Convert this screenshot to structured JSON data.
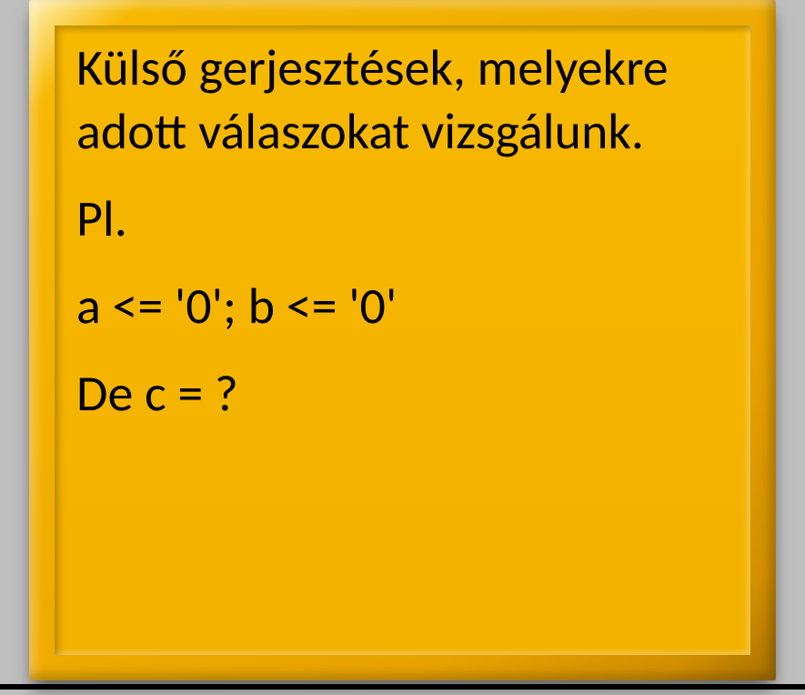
{
  "slide": {
    "para1": "Külső gerjesztések, melyekre adott válaszokat vizsgálunk.",
    "para2": "Pl.",
    "para3": "a <= '0';  b <= '0'",
    "para4": "De   c = ?"
  }
}
